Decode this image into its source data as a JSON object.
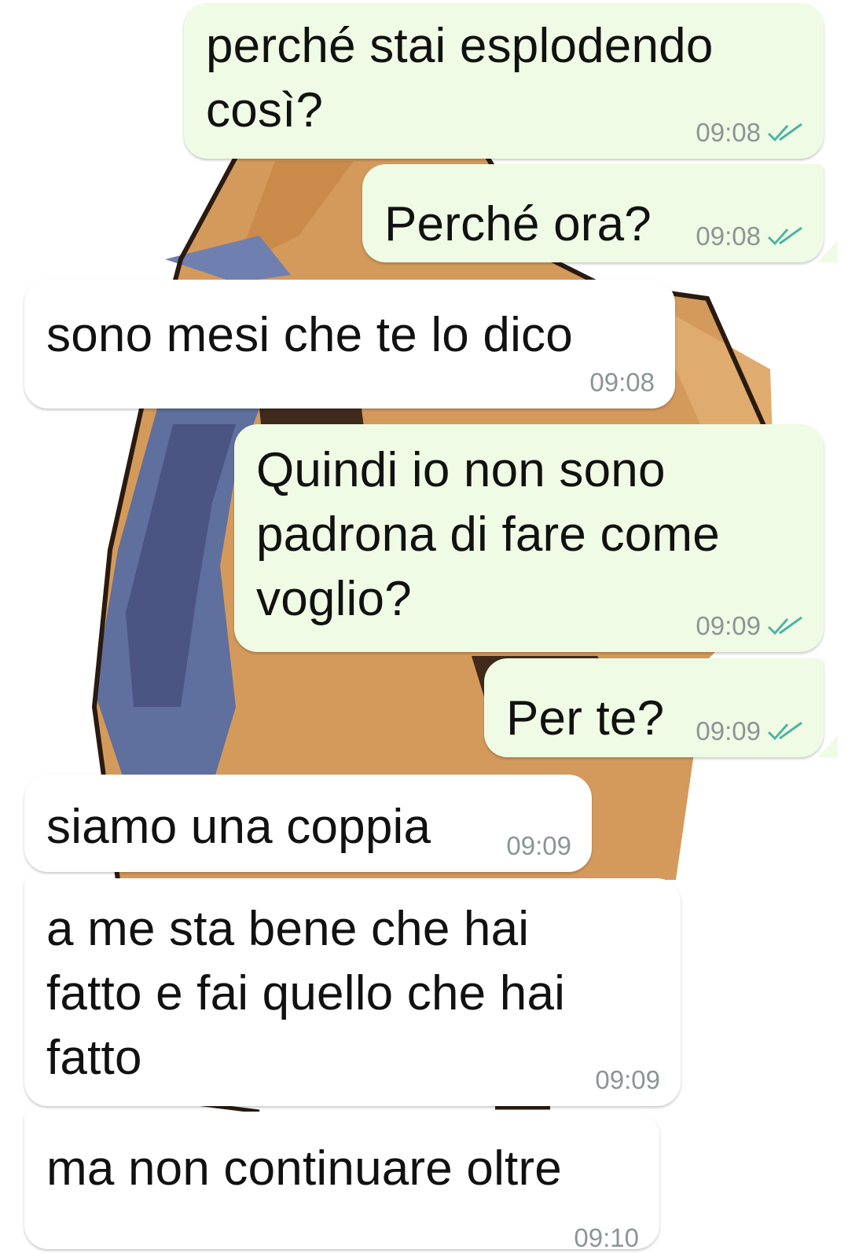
{
  "colors": {
    "outgoing_bg": "#effbe4",
    "incoming_bg": "#ffffff",
    "time": "#8b9596",
    "read_ticks": "#4fb3a3"
  },
  "messages": [
    {
      "direction": "outgoing",
      "text": "perché stai esplodendo\ncosì?",
      "time": "09:08",
      "status_icon": "double-check-read-icon"
    },
    {
      "direction": "outgoing",
      "text": "Perché ora?",
      "time": "09:08",
      "status_icon": "double-check-read-icon"
    },
    {
      "direction": "incoming",
      "text": "sono mesi che te lo dico",
      "time": "09:08"
    },
    {
      "direction": "outgoing",
      "text": "Quindi io non sono\npadrona di fare come\nvoglio?",
      "time": "09:09",
      "status_icon": "double-check-read-icon"
    },
    {
      "direction": "outgoing",
      "text": "Per te?",
      "time": "09:09",
      "status_icon": "double-check-read-icon"
    },
    {
      "direction": "incoming",
      "text": "siamo una coppia",
      "time": "09:09"
    },
    {
      "direction": "incoming",
      "text": "a me sta bene che hai\nfatto e fai quello che hai\nfatto",
      "time": "09:09"
    },
    {
      "direction": "incoming",
      "text": "ma non continuare oltre",
      "time": "09:10"
    }
  ]
}
